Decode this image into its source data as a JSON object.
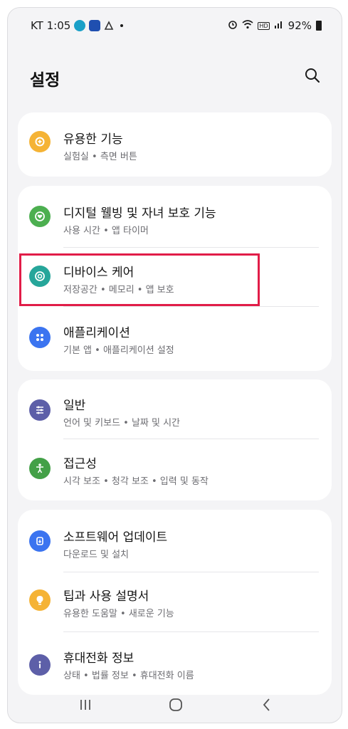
{
  "status_bar": {
    "carrier_time": "KT 1:05",
    "battery": "92%",
    "hd_label": "HD",
    "icons": [
      "teal-app-icon",
      "blue-app-icon",
      "gray-app-icon",
      "alarm-icon",
      "wifi-icon",
      "signal-icon",
      "battery-icon"
    ]
  },
  "header": {
    "title": "설정",
    "search_icon": "search-icon"
  },
  "sections": [
    {
      "items": [
        {
          "title": "유용한 기능",
          "subtitle": "실험실 • 측면 버튼",
          "icon": "plus-gear-icon",
          "color": "#f4b400"
        }
      ]
    },
    {
      "items": [
        {
          "title": "디지털 웰빙 및 자녀 보호 기능",
          "subtitle": "사용 시간 • 앱 타이머",
          "icon": "wellbeing-heart-icon",
          "color": "#4caf50"
        },
        {
          "title": "디바이스 케어",
          "subtitle": "저장공간 • 메모리 • 앱 보호",
          "icon": "device-care-icon",
          "color": "#26a69a"
        },
        {
          "title": "애플리케이션",
          "subtitle": "기본 앱 • 애플리케이션 설정",
          "icon": "apps-grid-icon",
          "color": "#3b74f0"
        }
      ]
    },
    {
      "items": [
        {
          "title": "일반",
          "subtitle": "언어 및 키보드 • 날짜 및 시간",
          "icon": "sliders-icon",
          "color": "#5d5fa8"
        },
        {
          "title": "접근성",
          "subtitle": "시각 보조 • 청각 보조 • 입력 및 동작",
          "icon": "accessibility-icon",
          "color": "#43a047"
        }
      ]
    },
    {
      "items": [
        {
          "title": "소프트웨어 업데이트",
          "subtitle": "다운로드 및 설치",
          "icon": "update-icon",
          "color": "#3b74f0"
        },
        {
          "title": "팁과 사용 설명서",
          "subtitle": "유용한 도움말 • 새로운 기능",
          "icon": "lightbulb-icon",
          "color": "#f4b400"
        },
        {
          "title": "휴대전화 정보",
          "subtitle": "상태 • 법률 정보 • 휴대전화 이름",
          "icon": "info-icon",
          "color": "#5d5fa8"
        }
      ]
    }
  ],
  "nav_bar": {
    "icons": [
      "recents-icon",
      "home-icon",
      "back-icon"
    ]
  }
}
